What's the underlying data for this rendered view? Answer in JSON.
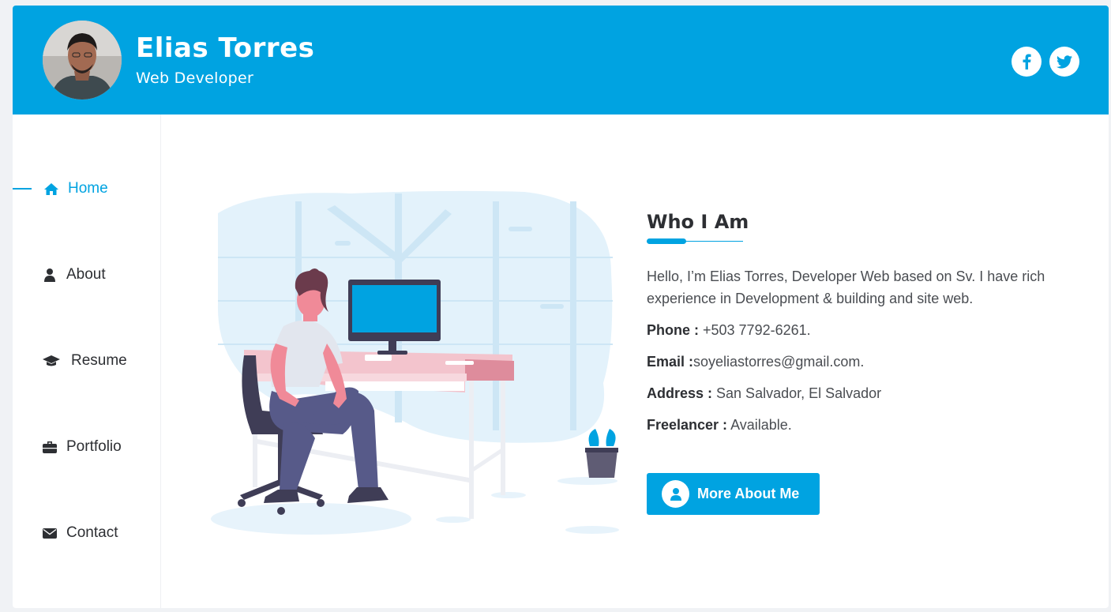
{
  "profile": {
    "name": "Elias Torres",
    "role": "Web Developer"
  },
  "social": [
    {
      "icon": "facebook-icon",
      "label": "f"
    },
    {
      "icon": "twitter-icon"
    }
  ],
  "nav": {
    "items": [
      {
        "label": "Home",
        "icon": "home-icon",
        "active": true
      },
      {
        "label": "About",
        "icon": "user-icon"
      },
      {
        "label": "Resume",
        "icon": "graduation-cap-icon"
      },
      {
        "label": "Portfolio",
        "icon": "briefcase-icon"
      },
      {
        "label": "Contact",
        "icon": "envelope-icon"
      }
    ]
  },
  "about": {
    "title": "Who I Am",
    "intro": "Hello, I’m Elias Torres, Developer Web based on Sv. I have rich experience in Development & building and site web.",
    "fields": [
      {
        "label": "Phone :",
        "value": " +503 7792-6261."
      },
      {
        "label": "Email :",
        "value": "soyeliastorres@gmail.com."
      },
      {
        "label": "Address :",
        "value": " San Salvador, El Salvador"
      },
      {
        "label": "Freelancer :",
        "value": " Available."
      }
    ],
    "button_label": "More About Me"
  },
  "colors": {
    "accent": "#00a3e1",
    "text": "#2d2f33"
  }
}
